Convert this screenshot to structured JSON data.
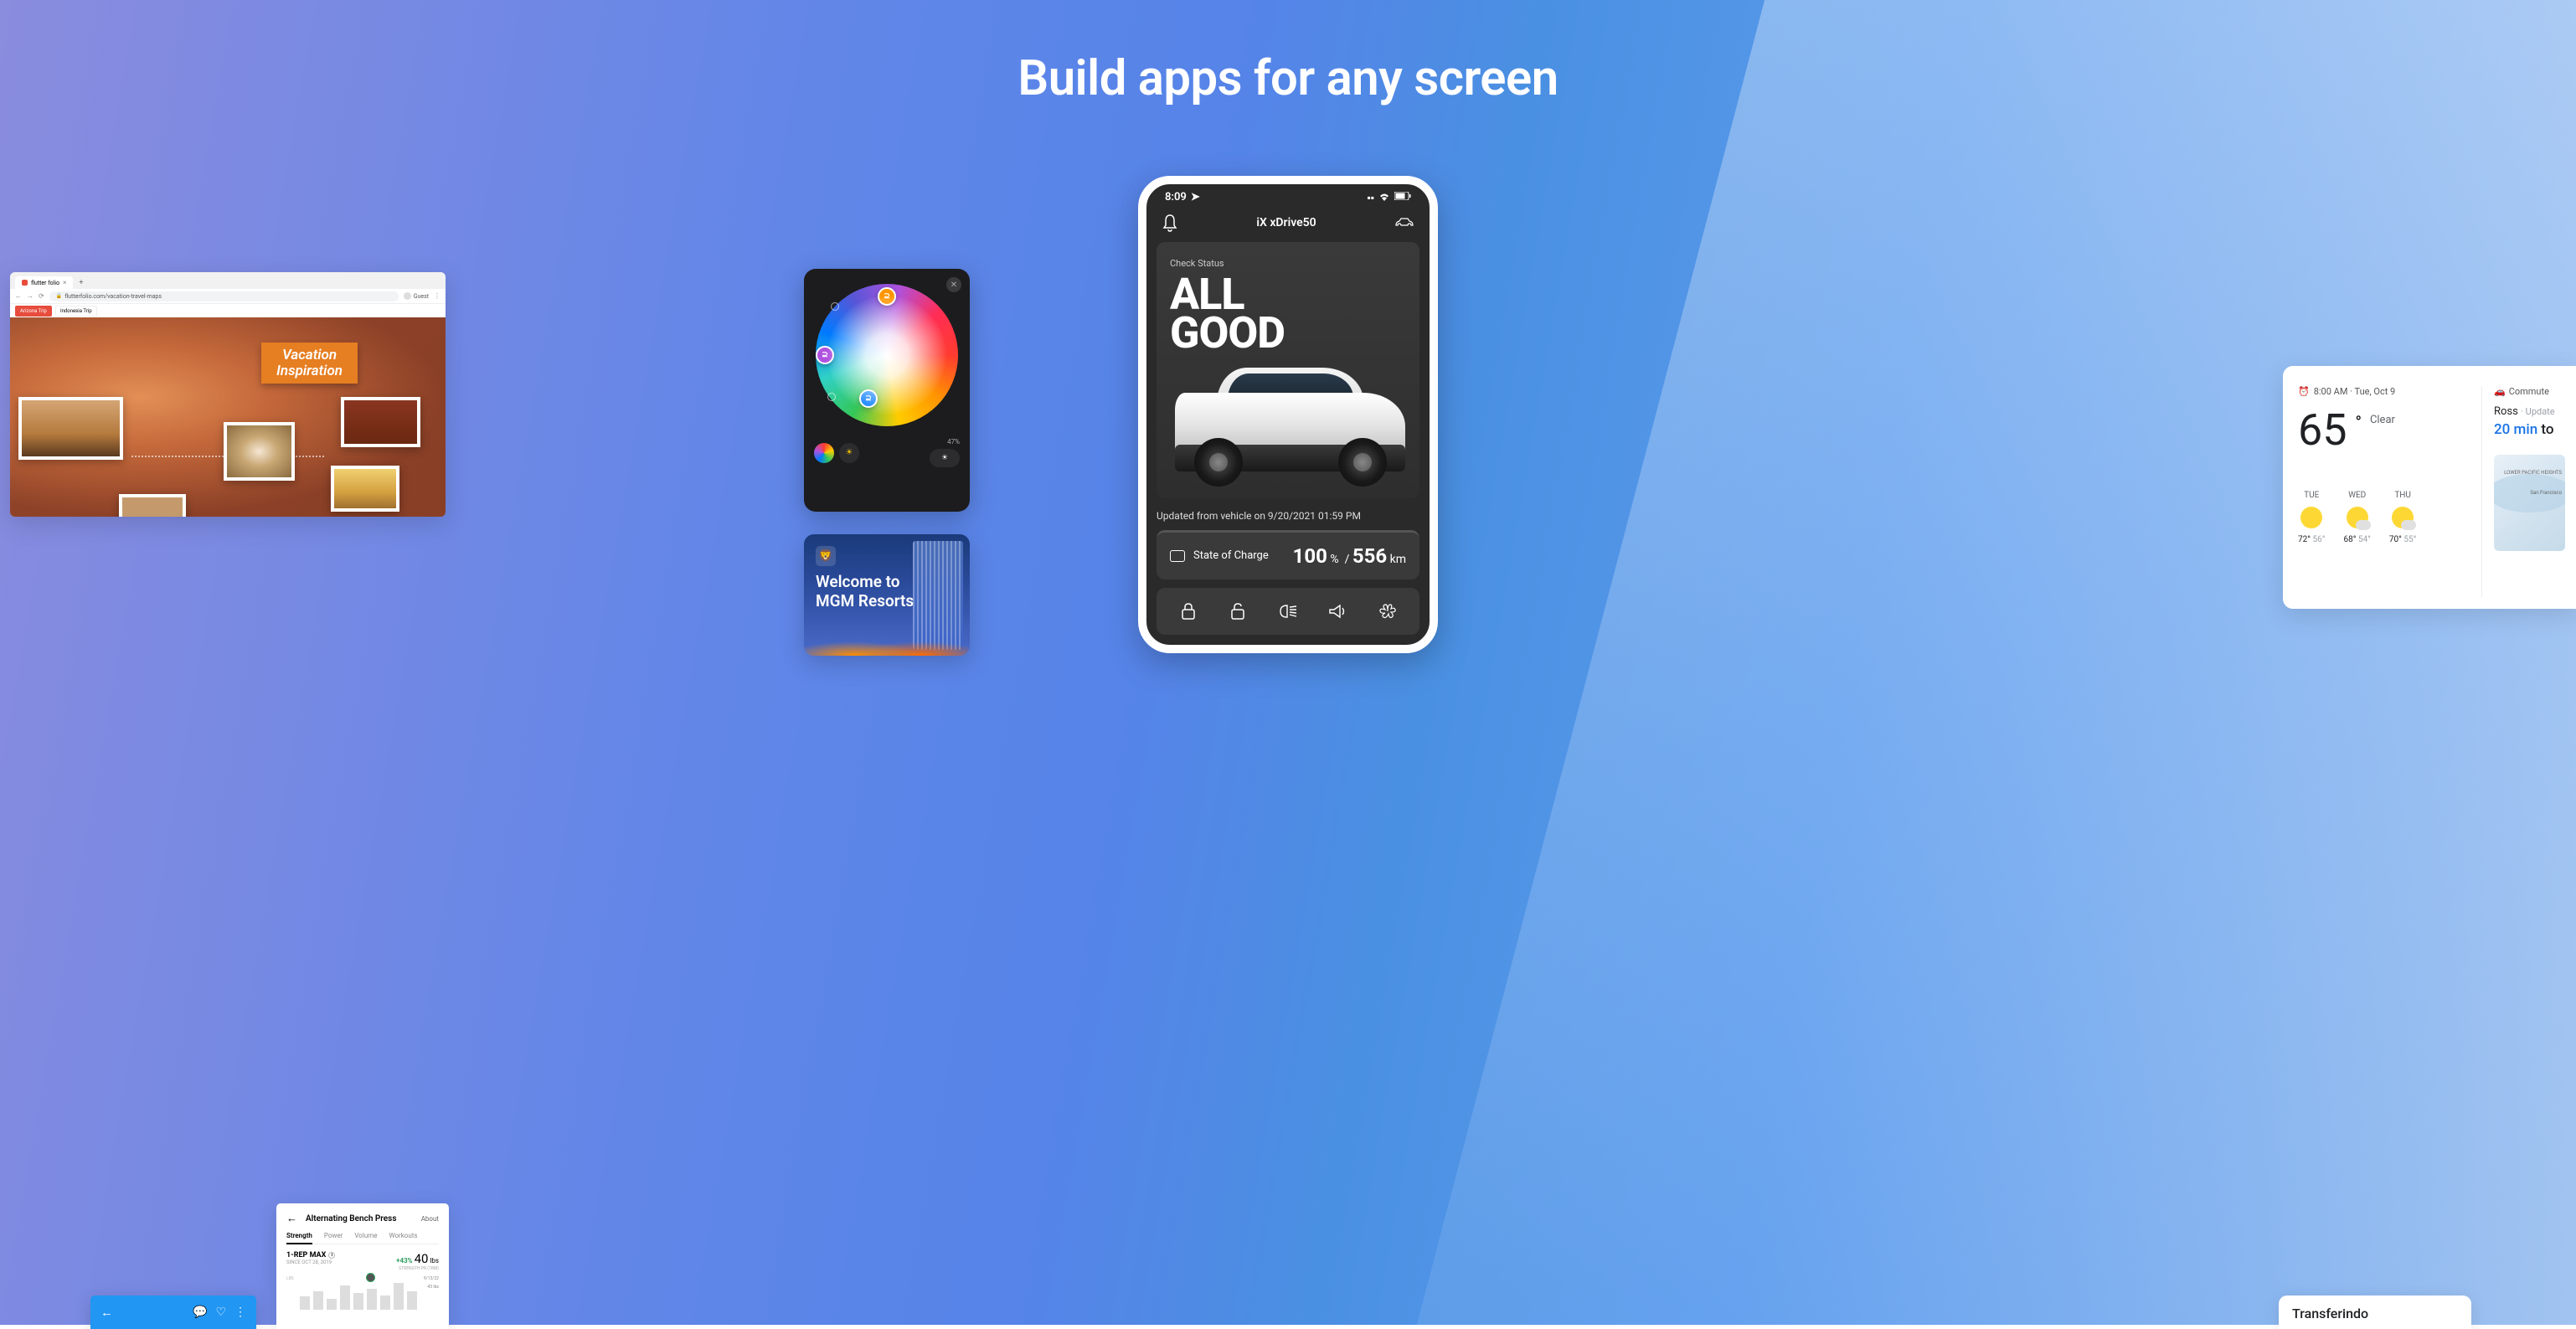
{
  "headline": "Build apps for any screen",
  "browser": {
    "tab_title": "flutter folio",
    "url": "flutterfolio.com/vacation-travel-maps",
    "guest_label": "Guest",
    "chip_active": "Arizona Trip",
    "chip_inactive": "Indonesia Trip",
    "banner_line1": "Vacation",
    "banner_line2": "Inspiration"
  },
  "phone": {
    "status_time": "8:09",
    "title": "iX xDrive50",
    "check_status": "Check Status",
    "big_text": "ALL\nGOOD",
    "updated": "Updated from vehicle on 9/20/2021 01:59 PM",
    "charge_label": "State of Charge",
    "charge_pct": "100",
    "charge_pct_unit": "%",
    "charge_sep": "/",
    "charge_km": "556",
    "charge_km_unit": "km"
  },
  "picker": {
    "percentage": "47%"
  },
  "weather": {
    "time": "8:00 AM · Tue, Oct 9",
    "temp": "65",
    "degree": "°",
    "condition": "Clear",
    "commute_label": "Commute",
    "ross": "Ross",
    "ross_sep": "· Update",
    "travel_time": "20 min",
    "travel_suffix": "to",
    "days": [
      {
        "name": "TUE",
        "hi": "72°",
        "lo": "56°"
      },
      {
        "name": "WED",
        "hi": "68°",
        "lo": "54°"
      },
      {
        "name": "THU",
        "hi": "70°",
        "lo": "55°"
      }
    ],
    "map_label1": "LOWER PACIFIC HEIGHTS",
    "map_label2": "San Francisco"
  },
  "mgm": {
    "line1": "Welcome to",
    "line2": "MGM Resorts"
  },
  "transfer": {
    "title": "Transferindo"
  },
  "fitness": {
    "title": "Alternating Bench Press",
    "about": "About",
    "tabs": [
      "Strength",
      "Power",
      "Volume",
      "Workouts"
    ],
    "stat_label": "1-REP MAX",
    "since": "SINCE OCT 28, 2019",
    "delta": "+43%",
    "value": "40",
    "unit": "lbs",
    "sub": "STRENGTH PR (1RM)",
    "ylabel": "LBS",
    "date1": "9/13/22",
    "date2": "43 lbs"
  }
}
